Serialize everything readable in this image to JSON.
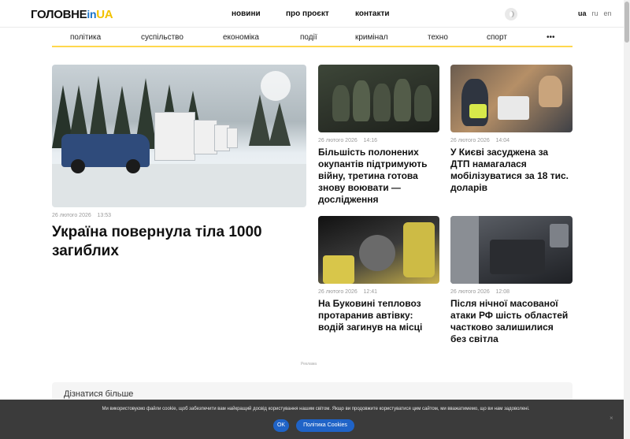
{
  "header": {
    "logo": {
      "part1": "ГОЛОВНЕ",
      "part2": "in",
      "part3": "UA"
    },
    "nav": [
      "новини",
      "про проєкт",
      "контакти"
    ],
    "languages": [
      "ua",
      "ru",
      "en"
    ],
    "active_language": "ua"
  },
  "categories": [
    "політика",
    "суспільство",
    "економіка",
    "події",
    "кримінал",
    "техно",
    "спорт",
    "•••"
  ],
  "hero": {
    "date": "26 лютого 2026",
    "time": "13:53",
    "title": "Україна повернула тіла 1000 загиблих"
  },
  "cards": [
    {
      "date": "26 лютого 2026",
      "time": "14:16",
      "title": "Більшість полонених окупантів підтримують війну, третина готова знову воювати — дослідження"
    },
    {
      "date": "26 лютого 2026",
      "time": "14:04",
      "title": "У Києві засуджена за ДТП намагалася мобілізуватися за 18 тис. доларів"
    },
    {
      "date": "26 лютого 2026",
      "time": "12:41",
      "title": "На Буковині тепловоз протаранив автівку: водій загинув на місці"
    },
    {
      "date": "26 лютого 2026",
      "time": "12:08",
      "title": "Після нічної масованої атаки РФ шість областей частково залишилися без світла"
    }
  ],
  "ad_label": "Реклама",
  "learn_more": "Дізнатися більше",
  "cookie": {
    "text": "Ми використовуємо файли cookie, щоб забезпечити вам найкращий досвід користування нашим світом. Якщо ви продовжите користуватися цим сайтом, ми вважатимемо, що ви нам задоволені.",
    "ok": "OK",
    "policy": "Політика Cookies"
  }
}
